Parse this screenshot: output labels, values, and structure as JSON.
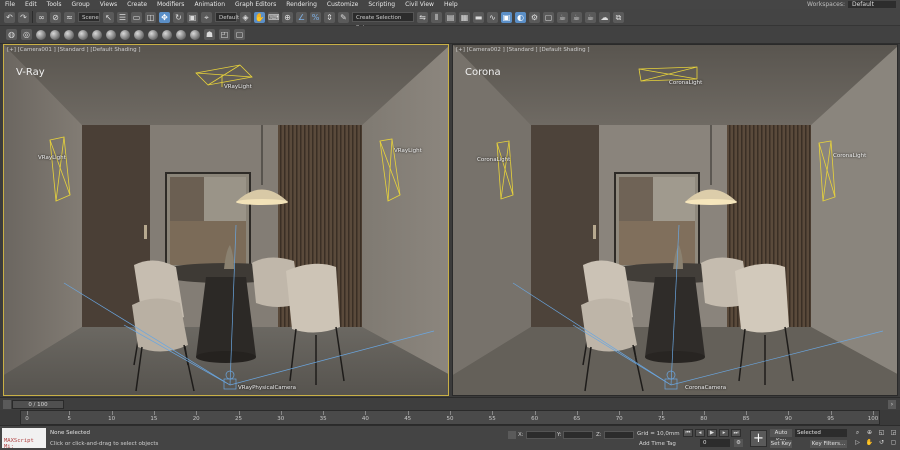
{
  "menubar": {
    "items": [
      "File",
      "Edit",
      "Tools",
      "Group",
      "Views",
      "Create",
      "Modifiers",
      "Animation",
      "Graph Editors",
      "Rendering",
      "Customize",
      "Scripting",
      "Civil View",
      "Help"
    ],
    "workspaces_label": "Workspaces:",
    "workspace_value": "Default"
  },
  "toolbar": {
    "selection_filter": "Scene",
    "reference_coord": "Default",
    "selection_set": "Create Selection Set"
  },
  "viewports": [
    {
      "label": "[+] [Camera001 ] [Standard ] [Default Shading ]",
      "title": "V-Ray",
      "lights": [
        "VRayLight",
        "VRayLight",
        "VRayLight"
      ],
      "camera": "VRayPhysicalCamera"
    },
    {
      "label": "[+] [Camera002 ] [Standard ] [Default Shading ]",
      "title": "Corona",
      "lights": [
        "CoronaLight",
        "CoronaLight",
        "CoronaLight"
      ],
      "camera": "CoronaCamera"
    }
  ],
  "timeline": {
    "frame_display": "0 / 100",
    "ticks": [
      "0",
      "5",
      "10",
      "15",
      "20",
      "25",
      "30",
      "35",
      "40",
      "45",
      "50",
      "55",
      "60",
      "65",
      "70",
      "75",
      "80",
      "85",
      "90",
      "95",
      "100"
    ]
  },
  "status": {
    "maxscript": "MAXScript Mi:",
    "selection": "None Selected",
    "prompt": "Click or click-and-drag to select objects",
    "x_label": "X:",
    "y_label": "Y:",
    "z_label": "Z:",
    "grid": "Grid = 10,0mm",
    "time_tag": "Add Time Tag",
    "frame_value": "0",
    "auto_key": "Auto Key",
    "set_key": "Set Key",
    "key_mode": "Selected",
    "key_filters": "Key Filters..."
  },
  "colors": {
    "light_gizmo": "#e8d33a",
    "camera_gizmo": "#6aa6e0",
    "active_viewport_border": "#c9b046"
  }
}
